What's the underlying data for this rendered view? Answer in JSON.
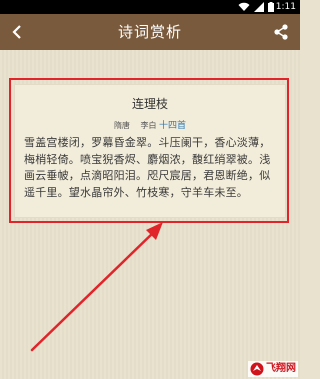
{
  "status_bar": {
    "time": "1:11",
    "icons": [
      "wifi-icon",
      "signal-icon",
      "battery-icon"
    ]
  },
  "app_bar": {
    "title": "诗词赏析",
    "back_icon": "chevron-left-icon",
    "share_icon": "share-icon",
    "color": "#7a5a3c"
  },
  "poem": {
    "title": "连理枝",
    "dynasty": "隋唐",
    "author": "李白",
    "collection_link": "十四首",
    "text": "雪盖宫楼闭，罗幕昏金翠。斗压阑干，香心淡薄，梅梢轻倚。喷宝猊香烬、麝烟浓，馥红绡翠被。浅画云垂帔，点滴昭阳泪。咫尺宸居，君恩断绝，似遥千里。望水晶帘外、竹枝寒，守羊车未至。"
  },
  "annotation": {
    "highlight_color": "#e0242a"
  },
  "watermark": {
    "text": "飞翔网"
  }
}
